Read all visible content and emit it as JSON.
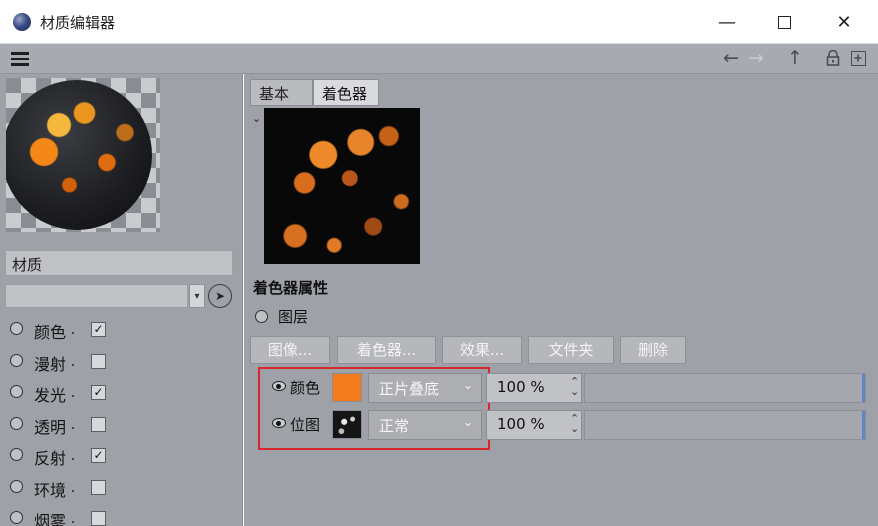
{
  "window": {
    "title": "材质编辑器",
    "minimize": "—",
    "close": "✕"
  },
  "toolbar": {
    "back_icon": "←",
    "forward_icon": "→",
    "up_icon": "↑"
  },
  "left": {
    "material_name": "材质",
    "channels": [
      {
        "label": "颜色",
        "checked": true
      },
      {
        "label": "漫射",
        "checked": false
      },
      {
        "label": "发光",
        "checked": true
      },
      {
        "label": "透明",
        "checked": false
      },
      {
        "label": "反射",
        "checked": true
      },
      {
        "label": "环境",
        "checked": false
      },
      {
        "label": "烟雾",
        "checked": false
      }
    ]
  },
  "tabs": {
    "basic": "基本",
    "shader": "着色器"
  },
  "shader": {
    "section_title": "着色器属性",
    "layer_label": "图层",
    "buttons": [
      "图像...",
      "着色器...",
      "效果...",
      "文件夹",
      "删除"
    ],
    "layers": [
      {
        "name": "颜色",
        "blend_mode": "正片叠底",
        "opacity": "100 %",
        "opacity_value": 100,
        "swatch_color": "#f47c1f"
      },
      {
        "name": "位图",
        "blend_mode": "正常",
        "opacity": "100 %",
        "opacity_value": 100
      }
    ]
  },
  "colors": {
    "panel_bg": "#9ea1a7",
    "highlight_box": "#d8262c"
  }
}
